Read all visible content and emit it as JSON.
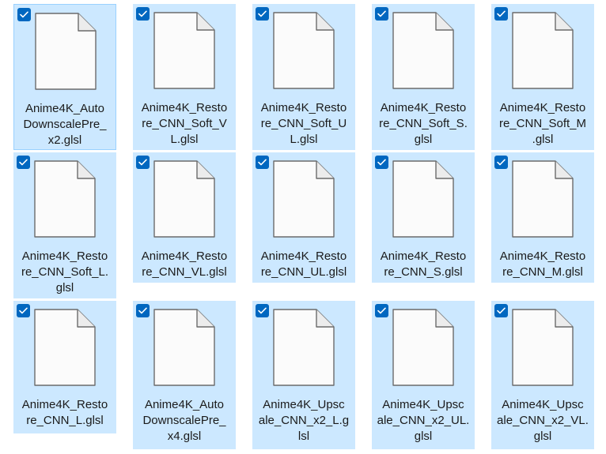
{
  "files": [
    {
      "name": "Anime4K_AutoDownscalePre_x2.glsl",
      "display_lines": [
        "Anime4K_Auto",
        "DownscalePre_",
        "x2.glsl"
      ],
      "selected": true,
      "icon": "document-icon"
    },
    {
      "name": "Anime4K_Restore_CNN_Soft_VL.glsl",
      "display_lines": [
        "Anime4K_Resto",
        "re_CNN_Soft_V",
        "L.glsl"
      ],
      "selected": true,
      "icon": "document-icon"
    },
    {
      "name": "Anime4K_Restore_CNN_Soft_UL.glsl",
      "display_lines": [
        "Anime4K_Resto",
        "re_CNN_Soft_U",
        "L.glsl"
      ],
      "selected": true,
      "icon": "document-icon"
    },
    {
      "name": "Anime4K_Restore_CNN_Soft_S.glsl",
      "display_lines": [
        "Anime4K_Resto",
        "re_CNN_Soft_S.",
        "glsl"
      ],
      "selected": true,
      "icon": "document-icon"
    },
    {
      "name": "Anime4K_Restore_CNN_Soft_M.glsl",
      "display_lines": [
        "Anime4K_Resto",
        "re_CNN_Soft_M",
        ".glsl"
      ],
      "selected": true,
      "icon": "document-icon"
    },
    {
      "name": "Anime4K_Restore_CNN_Soft_L.glsl",
      "display_lines": [
        "Anime4K_Resto",
        "re_CNN_Soft_L.",
        "glsl"
      ],
      "selected": true,
      "icon": "document-icon"
    },
    {
      "name": "Anime4K_Restore_CNN_VL.glsl",
      "display_lines": [
        "Anime4K_Resto",
        "re_CNN_VL.glsl"
      ],
      "selected": true,
      "icon": "document-icon"
    },
    {
      "name": "Anime4K_Restore_CNN_UL.glsl",
      "display_lines": [
        "Anime4K_Resto",
        "re_CNN_UL.glsl"
      ],
      "selected": true,
      "icon": "document-icon"
    },
    {
      "name": "Anime4K_Restore_CNN_S.glsl",
      "display_lines": [
        "Anime4K_Resto",
        "re_CNN_S.glsl"
      ],
      "selected": true,
      "icon": "document-icon"
    },
    {
      "name": "Anime4K_Restore_CNN_M.glsl",
      "display_lines": [
        "Anime4K_Resto",
        "re_CNN_M.glsl"
      ],
      "selected": true,
      "icon": "document-icon"
    },
    {
      "name": "Anime4K_Restore_CNN_L.glsl",
      "display_lines": [
        "Anime4K_Resto",
        "re_CNN_L.glsl"
      ],
      "selected": true,
      "icon": "document-icon"
    },
    {
      "name": "Anime4K_AutoDownscalePre_x4.glsl",
      "display_lines": [
        "Anime4K_Auto",
        "DownscalePre_",
        "x4.glsl"
      ],
      "selected": true,
      "icon": "document-icon"
    },
    {
      "name": "Anime4K_Upscale_CNN_x2_L.glsl",
      "display_lines": [
        "Anime4K_Upsc",
        "ale_CNN_x2_L.g",
        "lsl"
      ],
      "selected": true,
      "icon": "document-icon"
    },
    {
      "name": "Anime4K_Upscale_CNN_x2_UL.glsl",
      "display_lines": [
        "Anime4K_Upsc",
        "ale_CNN_x2_UL.",
        "glsl"
      ],
      "selected": true,
      "icon": "document-icon"
    },
    {
      "name": "Anime4K_Upscale_CNN_x2_VL.glsl",
      "display_lines": [
        "Anime4K_Upsc",
        "ale_CNN_x2_VL.",
        "glsl"
      ],
      "selected": true,
      "icon": "document-icon"
    }
  ],
  "colors": {
    "selection_bg": "#cce8ff",
    "focus_border": "#99d1ff",
    "checkbox": "#0067c0",
    "page_bg": "#ffffff",
    "text": "#1a1a1a"
  }
}
